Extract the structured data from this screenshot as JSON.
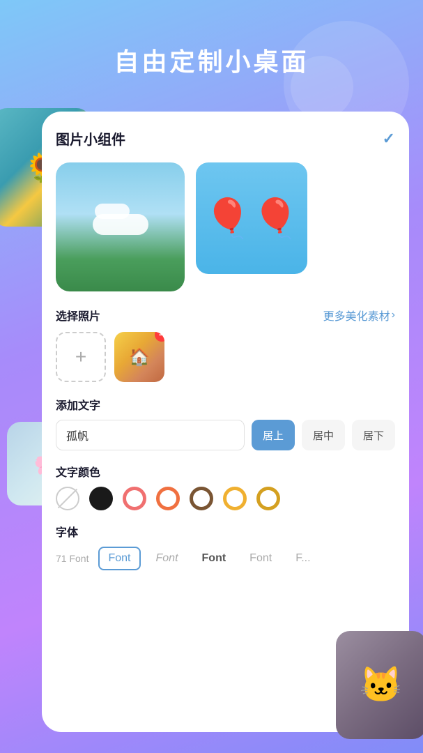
{
  "page": {
    "title": "自由定制小桌面",
    "background_gradient": "linear-gradient(160deg, #7ec8f8 0%, #a78bfa 40%, #c084fc 70%, #818cf8 100%)"
  },
  "card": {
    "title": "图片小组件",
    "check_icon": "✓"
  },
  "sections": {
    "select_photo": {
      "label": "选择照片",
      "more_link": "更多美化素材",
      "more_arrow": "›"
    },
    "add_text": {
      "label": "添加文字",
      "input_value": "孤帆",
      "align_buttons": [
        "居上",
        "居中",
        "居下"
      ],
      "active_align": 0
    },
    "text_color": {
      "label": "文字颜色",
      "colors": [
        {
          "name": "none",
          "type": "none"
        },
        {
          "name": "black",
          "color": "#1a1a1a",
          "type": "solid"
        },
        {
          "name": "pink",
          "color": "#f07070",
          "type": "donut"
        },
        {
          "name": "orange",
          "color": "#f07040",
          "type": "donut"
        },
        {
          "name": "brown",
          "color": "#7a5533",
          "type": "donut"
        },
        {
          "name": "yellow",
          "color": "#f0b030",
          "type": "donut"
        },
        {
          "name": "gold",
          "color": "#d4a020",
          "type": "donut"
        }
      ]
    },
    "font": {
      "label": "字体",
      "count": "71",
      "count_suffix": "Font",
      "items": [
        {
          "label": "Font",
          "style": "selected"
        },
        {
          "label": "Font",
          "style": "italic"
        },
        {
          "label": "Font",
          "style": "bold"
        },
        {
          "label": "Font",
          "style": "regular"
        },
        {
          "label": "F...",
          "style": "regular"
        }
      ]
    }
  }
}
